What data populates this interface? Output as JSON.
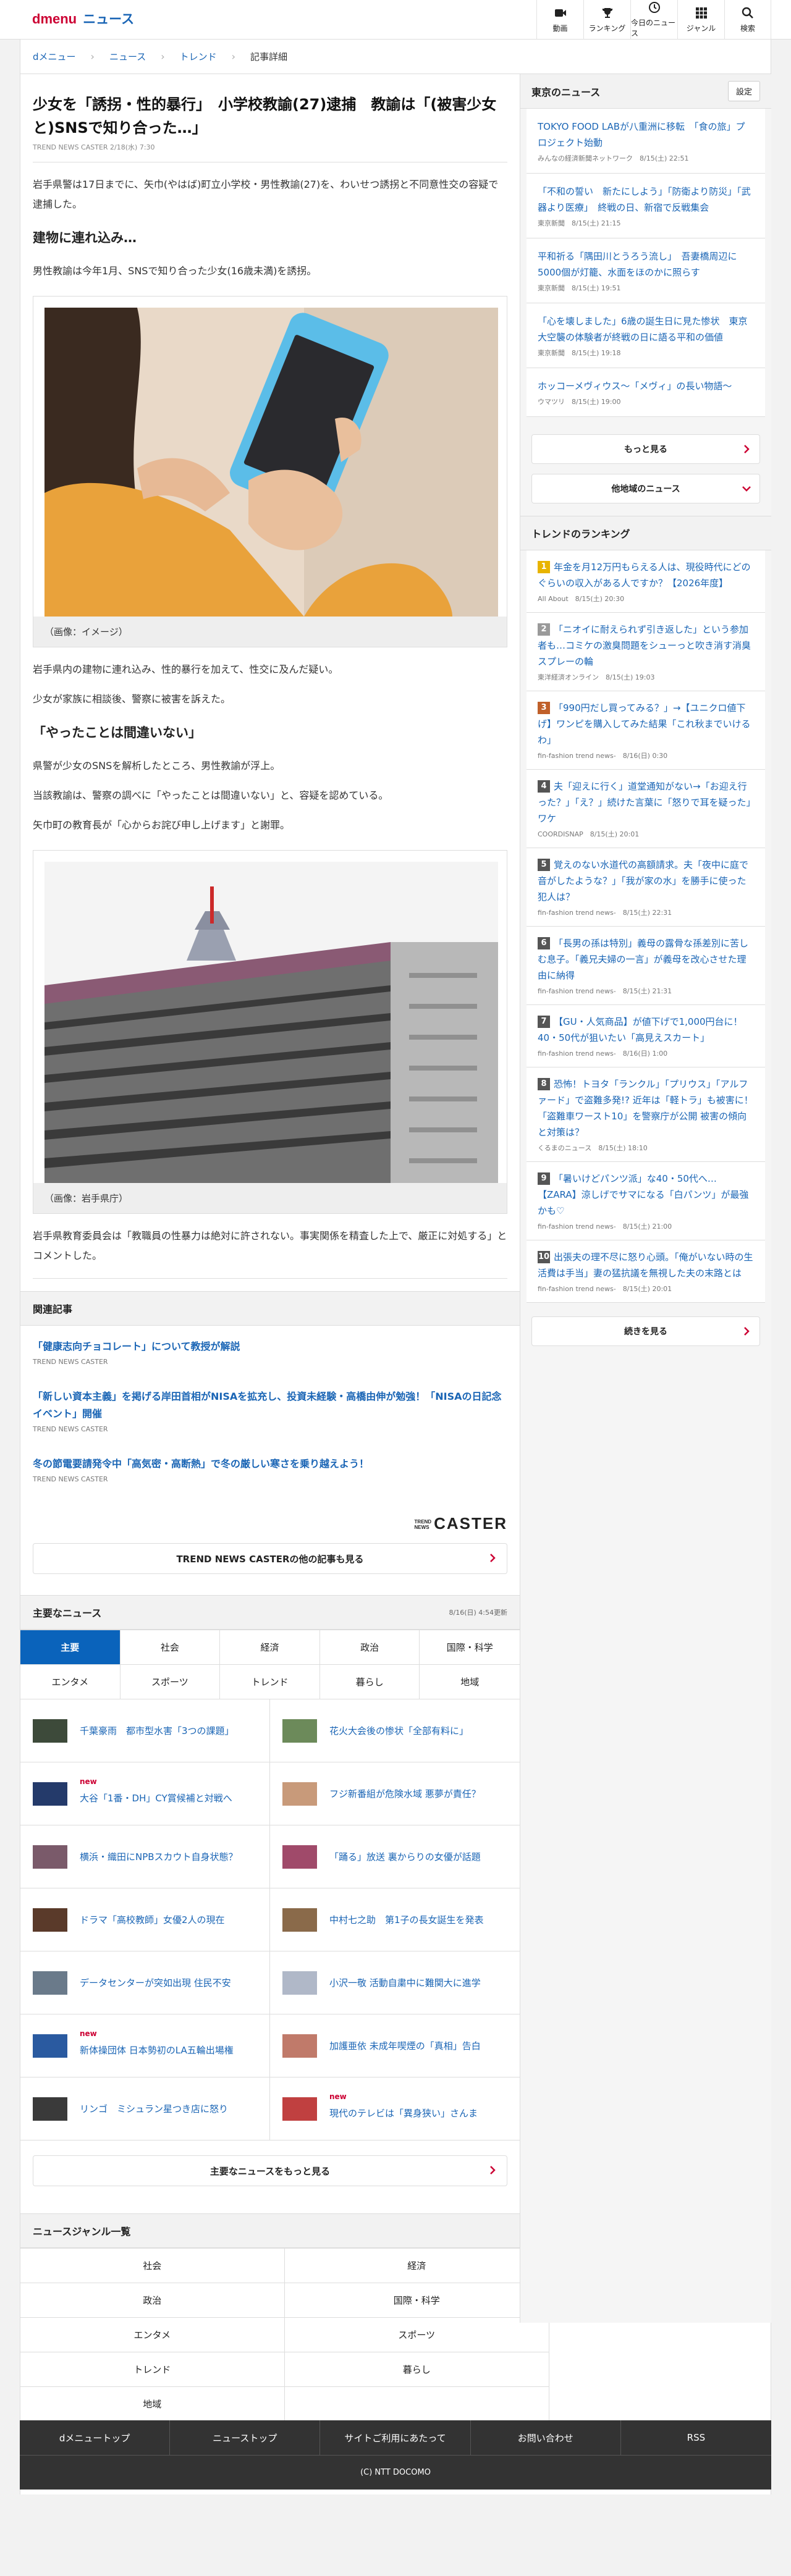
{
  "header": {
    "logo_d": "dmenu",
    "logo_news": "ニュース",
    "nav": [
      {
        "label": "動画",
        "icon": "video-icon"
      },
      {
        "label": "ランキング",
        "icon": "trophy-icon"
      },
      {
        "label": "今日のニュース",
        "icon": "clock-icon"
      },
      {
        "label": "ジャンル",
        "icon": "grid-icon"
      },
      {
        "label": "検索",
        "icon": "search-icon"
      }
    ]
  },
  "breadcrumb": [
    "dメニュー",
    "ニュース",
    "トレンド",
    "記事詳細"
  ],
  "article": {
    "title": "少女を「誘拐・性的暴行」　小学校教諭(27)逮捕　教諭は「(被害少女と)SNSで知り合った…」",
    "date": "TREND NEWS CASTER 2/18(水) 7:30",
    "p1": "岩手県警は17日までに、矢巾(やはば)町立小学校・男性教諭(27)を、わいせつ誘拐と不同意性交の容疑で逮捕した。",
    "h1": "建物に連れ込み…",
    "p2": "男性教諭は今年1月、SNSで知り合った少女(16歳未満)を誘拐。",
    "cap1": "（画像：イメージ）",
    "p3": "岩手県内の建物に連れ込み、性的暴行を加えて、性交に及んだ疑い。",
    "p4": "少女が家族に相談後、警察に被害を訴えた。",
    "h2": "「やったことは間違いない」",
    "p5": "県警が少女のSNSを解析したところ、男性教諭が浮上。",
    "p6": "当該教諭は、警察の調べに「やったことは間違いない」と、容疑を認めている。",
    "p7": "矢巾町の教育長が「心からお詫び申し上げます」と謝罪。",
    "cap2": "（画像：岩手県庁）",
    "p8": "岩手県教育委員会は「教職員の性暴力は絶対に許されない。事実関係を精査した上で、厳正に対処する」とコメントした。"
  },
  "related": {
    "heading": "関連記事",
    "items": [
      {
        "title": "「健康志向チョコレート」について教授が解説",
        "source": "TREND NEWS CASTER"
      },
      {
        "title": "「新しい資本主義」を掲げる岸田首相がNISAを拡充し、投資未経験・高橋由伸が勉強！「NISAの日記念イベント」開催",
        "source": "TREND NEWS CASTER"
      },
      {
        "title": "冬の節電要請発令中「高気密・高断熱」で冬の厳しい寒さを乗り越えよう！",
        "source": "TREND NEWS CASTER"
      }
    ],
    "caster_small_1": "TREND",
    "caster_small_2": "NEWS",
    "caster_logo": "CASTER",
    "more_label": "TREND NEWS CASTERの他の記事も見る"
  },
  "major": {
    "heading": "主要なニュース",
    "updated": "8/16(日) 4:54更新",
    "tabs": [
      "主要",
      "社会",
      "経済",
      "政治",
      "国際・科学",
      "エンタメ",
      "スポーツ",
      "トレンド",
      "暮らし",
      "地域"
    ],
    "items": [
      {
        "title": "千葉豪雨　都市型水害「3つの課題」",
        "new": ""
      },
      {
        "title": "花火大会後の惨状「全部有料に」",
        "new": ""
      },
      {
        "title": "大谷「1番・DH」CY賞候補と対戦へ",
        "new": "new"
      },
      {
        "title": "フジ新番組が危険水域 悪夢が責任？",
        "new": ""
      },
      {
        "title": "横浜・織田にNPBスカウト自身状態？",
        "new": ""
      },
      {
        "title": "「踊る」放送 裏からりの女優が話題",
        "new": ""
      },
      {
        "title": "ドラマ「高校教師」女優2人の現在",
        "new": ""
      },
      {
        "title": "中村七之助　第1子の長女誕生を発表",
        "new": ""
      },
      {
        "title": "データセンターが突如出現 住民不安",
        "new": ""
      },
      {
        "title": "小沢一敬 活動自粛中に難関大に進学",
        "new": ""
      },
      {
        "title": "新体操団体 日本勢初のLA五輪出場権",
        "new": "new"
      },
      {
        "title": "加護亜依 未成年喫煙の「真相」告白",
        "new": ""
      },
      {
        "title": "リンゴ　ミシュラン星つき店に怒り",
        "new": ""
      },
      {
        "title": "現代のテレビは「異身狭い」さんま",
        "new": "new"
      }
    ],
    "more_label": "主要なニュースをもっと見る"
  },
  "genre": {
    "heading": "ニュースジャンル一覧",
    "items": [
      "社会",
      "経済",
      "政治",
      "国際・科学",
      "エンタメ",
      "スポーツ",
      "トレンド",
      "暮らし",
      "地域",
      ""
    ]
  },
  "side": {
    "tokyo_heading": "東京のニュース",
    "settings_label": "設定",
    "tokyo": [
      {
        "title": "TOKYO FOOD LABが八重洲に移転　「食の旅」プロジェクト始動",
        "meta": "みんなの経済新聞ネットワーク　8/15(土) 22:51"
      },
      {
        "title": "「不和の誓い　新たにしよう」「防衛より防災」「武器より医療」　終戦の日、新宿で反戦集会",
        "meta": "東京新聞　8/15(土) 21:15"
      },
      {
        "title": "平和祈る「隅田川とうろう流し」　吾妻橋周辺に5000個が灯籠、水面をほのかに照らす",
        "meta": "東京新聞　8/15(土) 19:51"
      },
      {
        "title": "「心を壊しました」6歳の誕生日に見た惨状　東京大空襲の体験者が終戦の日に語る平和の価値",
        "meta": "東京新聞　8/15(土) 19:18"
      },
      {
        "title": "ホッコーメヴィウス～「メヴィ」の長い物語～",
        "meta": "ウマツリ　8/15(土) 19:00"
      }
    ],
    "tokyo_more": "もっと見る",
    "other_region": "他地域のニュース",
    "rank_heading": "トレンドのランキング",
    "ranking": [
      {
        "title": "年金を月12万円もらえる人は、現役時代にどのぐらいの収入がある人ですか？【2026年度】",
        "meta": "All About　8/15(土) 20:30",
        "color": "#e8b400"
      },
      {
        "title": "「ニオイに耐えられず引き返した」という参加者も…コミケの激臭問題をシューっと吹き消す消臭スプレーの輪",
        "meta": "東洋経済オンライン　8/15(土) 19:03",
        "color": "#9a9a9a"
      },
      {
        "title": "「990円だし買ってみる？」→【ユニクロ値下げ】ワンピを購入してみた結果「これ秋までいけるわ」",
        "meta": "fin-fashion trend news-　8/16(日) 0:30",
        "color": "#c0602a"
      },
      {
        "title": "夫「迎えに行く」道堂通知がない→「お迎え行った？」「え？」続けた言葉に「怒りで耳を疑った」ワケ",
        "meta": "COORDISNAP　8/15(土) 20:01",
        "color": "#555555"
      },
      {
        "title": "覚えのない水道代の高額請求。夫「夜中に庭で音がしたような？」「我が家の水」を勝手に使った犯人は？",
        "meta": "fin-fashion trend news-　8/15(土) 22:31",
        "color": "#555555"
      },
      {
        "title": "「長男の孫は特別」義母の露骨な孫差別に苦しむ息子。「義兄夫婦の一言」が義母を改心させた理由に納得",
        "meta": "fin-fashion trend news-　8/15(土) 21:31",
        "color": "#555555"
      },
      {
        "title": "【GU・人気商品】が値下げで1,000円台に！40・50代が狙いたい「高見えスカート」",
        "meta": "fin-fashion trend news-　8/16(日) 1:00",
        "color": "#555555"
      },
      {
        "title": "恐怖！トヨタ「ランクル」「プリウス」「アルファード」で盗難多発!? 近年は「軽トラ」も被害に！「盗難車ワースト10」を警察庁が公開 被害の傾向と対策は？",
        "meta": "くるまのニュース　8/15(土) 18:10",
        "color": "#555555"
      },
      {
        "title": "「暑いけどパンツ派」な40・50代へ…【ZARA】涼しげでサマになる「白パンツ」が最強かも♡",
        "meta": "fin-fashion trend news-　8/15(土) 21:00",
        "color": "#555555"
      },
      {
        "title": "出張夫の理不尽に怒り心頭。「俺がいない時の生活費は手当」妻の猛抗議を無視した夫の末路とは",
        "meta": "fin-fashion trend news-　8/15(土) 20:01",
        "color": "#555555"
      }
    ],
    "rank_more": "続きを見る"
  },
  "footer": {
    "nav": [
      "dメニュートップ",
      "ニューストップ",
      "サイトご利用にあたって",
      "お問い合わせ",
      "RSS"
    ],
    "copyright": "(C) NTT DOCOMO"
  }
}
